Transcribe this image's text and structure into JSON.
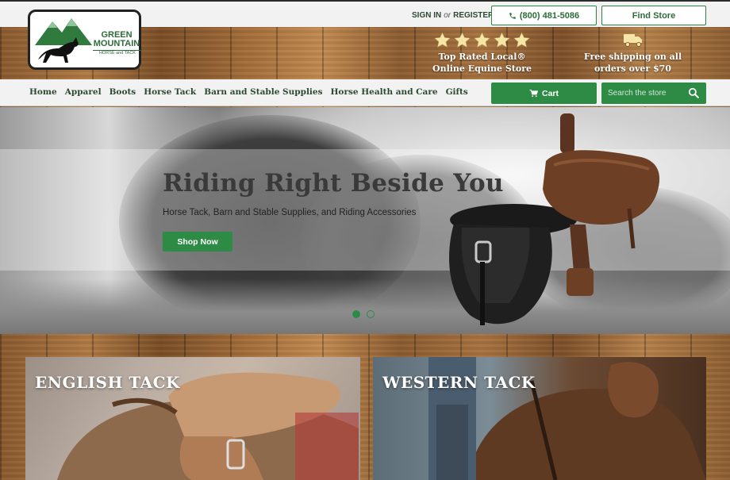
{
  "header": {
    "sign_in": "SIGN IN",
    "or": "or",
    "register": "REGISTER",
    "phone": "(800) 481-5086",
    "find_store": "Find Store"
  },
  "logo": {
    "line1": "GREEN",
    "line2": "MOUNTAIN",
    "sub": "HORSE and TACK"
  },
  "features": [
    {
      "icon": "star-icon",
      "line1": "Top Rated Local®",
      "line2": "Online Equine Store"
    },
    {
      "icon": "truck-icon",
      "line1": "Free shipping on all",
      "line2": "orders over $70"
    }
  ],
  "nav": {
    "items": [
      "Home",
      "Apparel",
      "Boots",
      "Horse Tack",
      "Barn and Stable Supplies",
      "Horse Health and Care",
      "Gifts"
    ],
    "cart": "Cart",
    "search_placeholder": "Search the store"
  },
  "hero": {
    "title": "Riding Right Beside You",
    "subtitle": "Horse Tack, Barn and Stable Supplies, and Riding Accessories",
    "cta": "Shop Now",
    "slides": 2,
    "active_slide": 1
  },
  "categories": [
    {
      "title": "ENGLISH TACK"
    },
    {
      "title": "WESTERN TACK"
    }
  ],
  "colors": {
    "brand_green": "#2e8b45",
    "nav_text": "#2b4a2f"
  }
}
